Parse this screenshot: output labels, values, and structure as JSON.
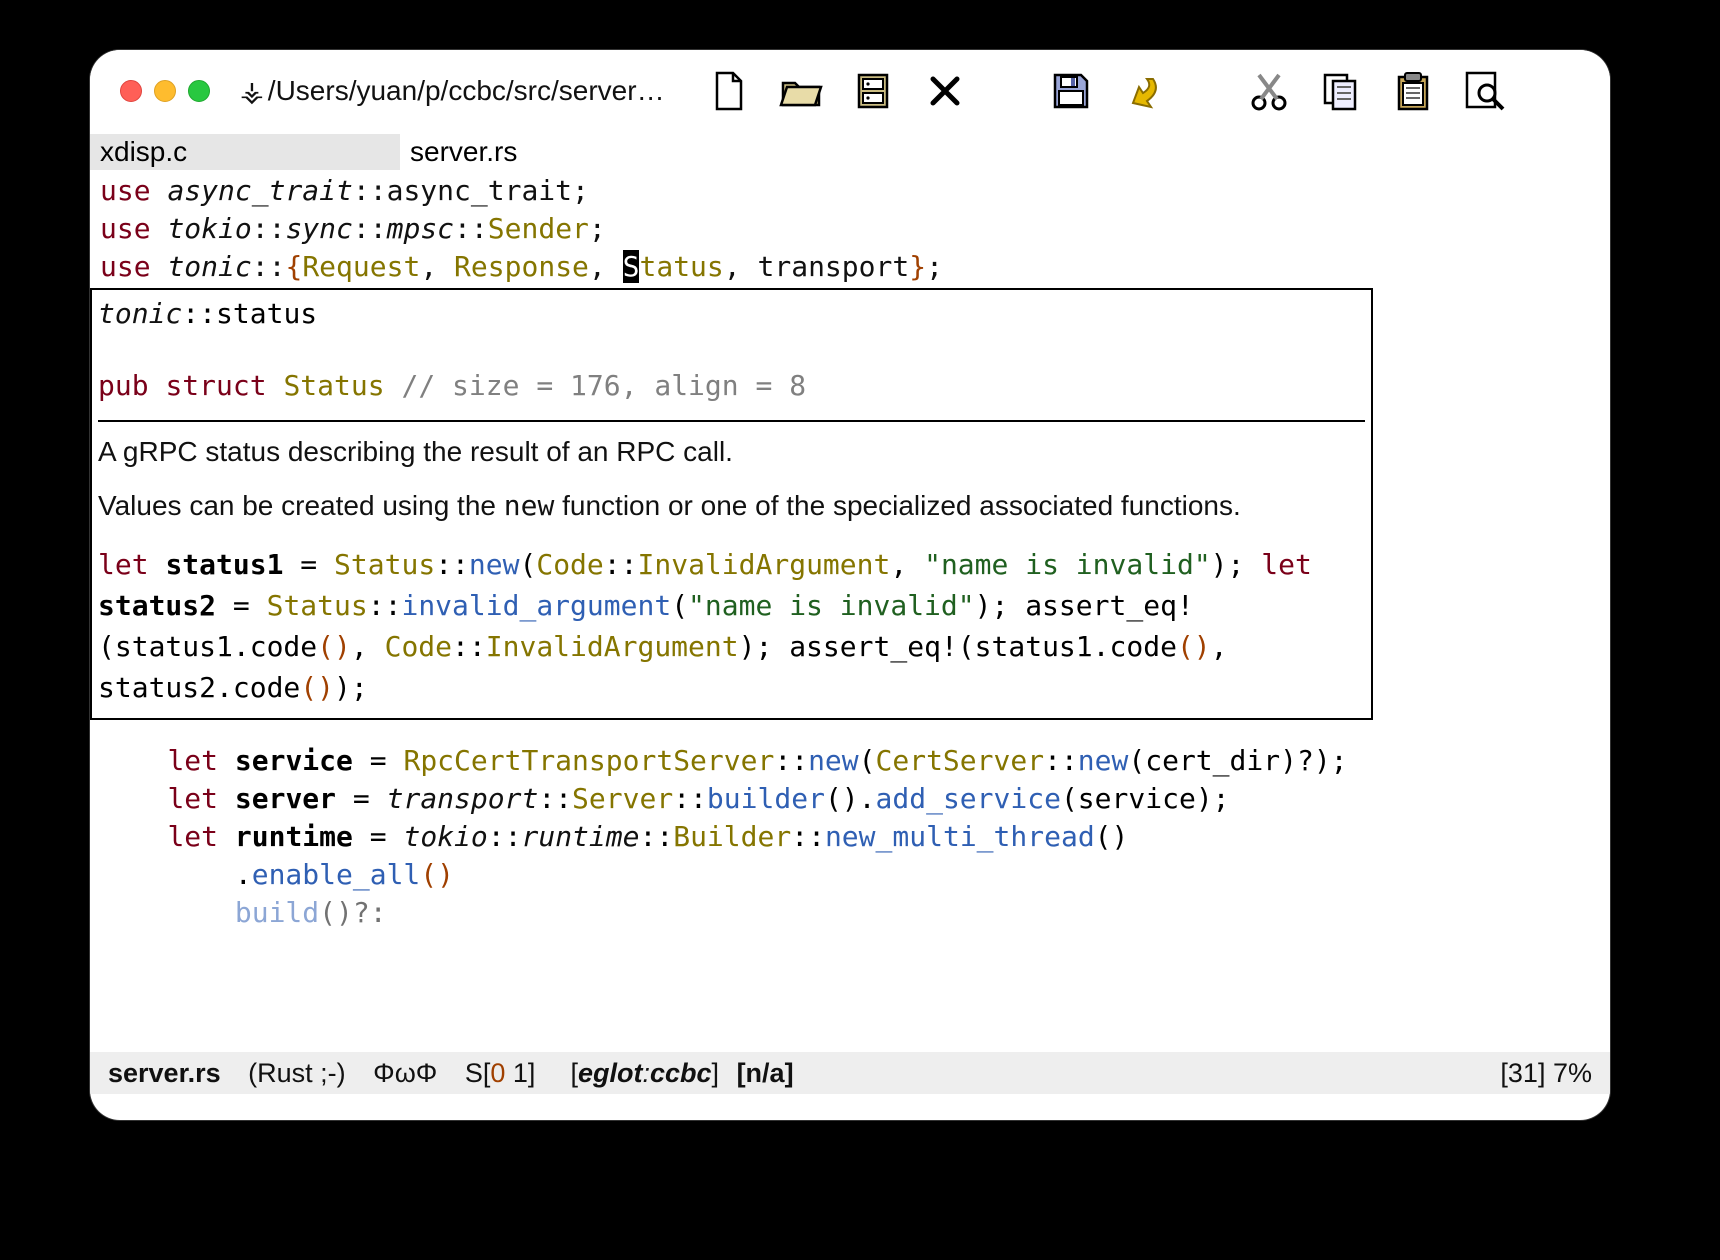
{
  "titlebar": {
    "vc_glyph": "⚶",
    "path": "/Users/yuan/p/ccbc/src/server…"
  },
  "toolbar_icons": [
    "new-file-icon",
    "open-folder-icon",
    "dired-icon",
    "kill-buffer-icon",
    "save-icon",
    "undo-icon",
    "cut-icon",
    "copy-icon",
    "paste-icon",
    "search-icon"
  ],
  "tabs": [
    {
      "label": "xdisp.c",
      "active": true
    },
    {
      "label": "server.rs",
      "active": false
    }
  ],
  "code": {
    "line1": {
      "kw": "use",
      "path": "async_trait",
      "rest": "::async_trait;"
    },
    "line2": {
      "kw": "use",
      "path": "tokio",
      "seg2": "sync",
      "seg3": "mpsc",
      "type": "Sender",
      "end": ";"
    },
    "line3": {
      "kw": "use",
      "path": "tonic",
      "open": "{",
      "t1": "Request",
      "t2": "Response",
      "cursor": "S",
      "t3rest": "tatus",
      "t4": "transport",
      "close": "}",
      "end": ";"
    }
  },
  "hover": {
    "path_prefix": "tonic",
    "path_rest": "::status",
    "sig": {
      "pub": "pub",
      "struct": "struct",
      "name": "Status",
      "cmt": "// size = 176, align = 8"
    },
    "p1": "A gRPC status describing the result of an RPC call.",
    "p2a": "Values can be created using the ",
    "p2_code": "new",
    "p2b": " function or one of the specialized associated functions.",
    "ex": {
      "l1": {
        "let": "let",
        "b": "status1",
        "eq": " = ",
        "ty": "Status",
        "fn": "new",
        "arg1_ty": "Code",
        "arg1_fld": "InvalidArgument",
        "str": "\"name is invalid\"",
        "end": ");"
      },
      "l2": {
        "let": "let",
        "b": "status2",
        "eq": " = ",
        "ty": "Status",
        "fn": "invalid_argument",
        "str": "\"name is invalid\"",
        "end": ");"
      },
      "l3": {
        "macro": "assert_eq!",
        "a": "(status1.code",
        "paren": "()",
        ", ": ", ",
        "ty": "Code",
        "fld": "InvalidArgument",
        "end": ");"
      },
      "l4": {
        "macro": "assert_eq!",
        "body": "(status1.code",
        "p1": "()",
        ", ": ", ",
        "body2": "status2.code",
        "p2": "()",
        "end": ");"
      }
    }
  },
  "resumed": {
    "l1": {
      "let": "let",
      "b": "service",
      "eq": " = ",
      "ty": "RpcCertTransportServer",
      "fn1": "new",
      "ty2": "CertServer",
      "fn2": "new",
      "arg": "(cert_dir)?",
      "end": ");"
    },
    "l2": {
      "let": "let",
      "b": "server",
      "eq": " = ",
      "path": "transport",
      "ty": "Server",
      "fn1": "builder",
      "mid": "().",
      "fn2": "add_service",
      "arg": "(service);"
    },
    "l3": {
      "let": "let",
      "b": "runtime",
      "eq": " = ",
      "path": "tokio",
      "path2": "runtime",
      "ty": "Builder",
      "fn": "new_multi_thread",
      "end": "()"
    },
    "l4_fn": "enable_all",
    "l4_paren": "()",
    "l5_fn": "build",
    "l5_rest": "()?:"
  },
  "modeline": {
    "buffer": "server.rs",
    "mode": "(Rust ;-)",
    "misc": "ΦωΦ",
    "flyS": "S[",
    "fly0": "0 ",
    "fly1": "1",
    "flyEnd": "]",
    "eglot_open": "[",
    "eglot_lbl": "eglot",
    "eglot_sep": ":",
    "eglot_srv": "ccbc",
    "eglot_close": "]",
    "na": "[n/a]",
    "line": "[31]",
    "pct": "7%"
  }
}
